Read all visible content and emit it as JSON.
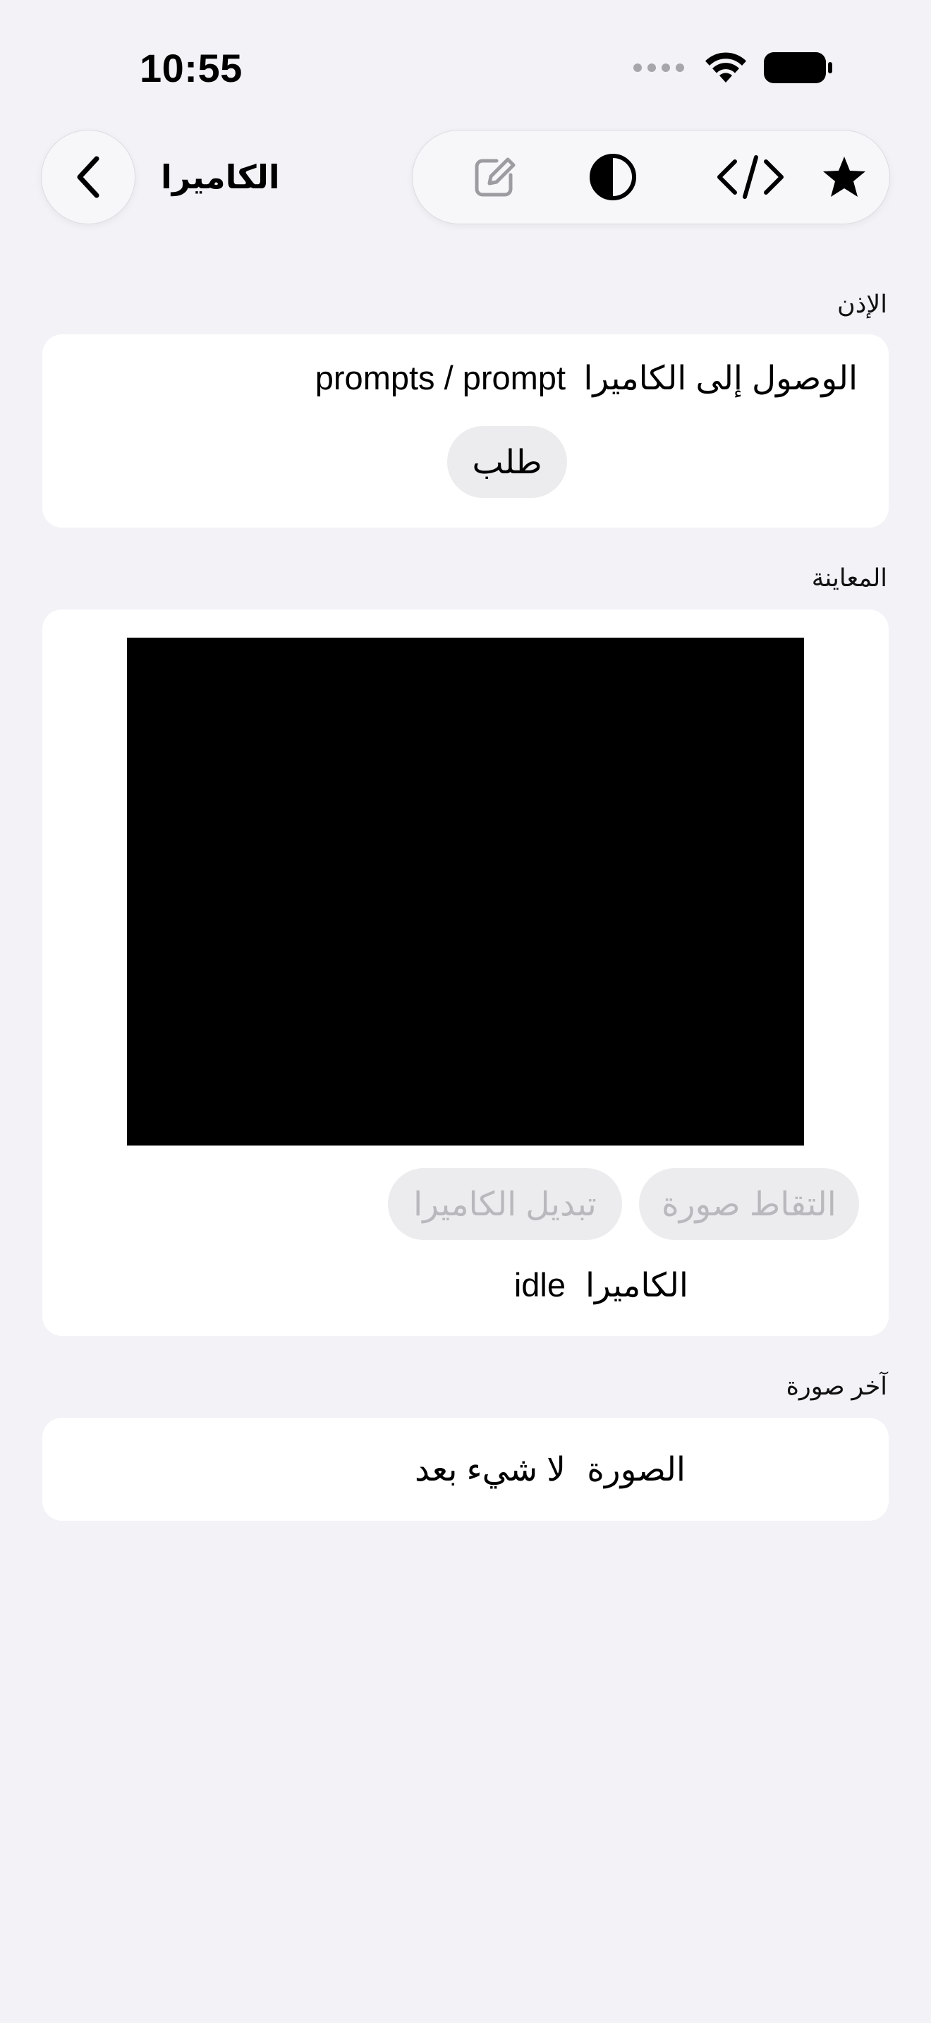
{
  "status_bar": {
    "time": "10:55"
  },
  "nav": {
    "title": "الكاميرا",
    "back_icon": "chevron-left-icon",
    "actions": [
      {
        "name": "edit-icon"
      },
      {
        "name": "contrast-icon"
      },
      {
        "name": "code-icon"
      },
      {
        "name": "star-icon"
      }
    ]
  },
  "permission": {
    "header": "الإذن",
    "label": "الوصول إلى الكاميرا",
    "value": "prompts / prompt",
    "request_button": "طلب"
  },
  "preview": {
    "header": "المعاينة",
    "capture_button": "التقاط صورة",
    "switch_button": "تبديل الكاميرا",
    "status_label": "الكاميرا",
    "status_value": "idle"
  },
  "last_photo": {
    "header": "آخر صورة",
    "label": "الصورة",
    "value": "لا شيء بعد"
  },
  "colors": {
    "background": "#f2f2f7",
    "card": "#ffffff",
    "button_fill": "#ececee",
    "disabled_text": "#b9b9bd",
    "preview": "#000000"
  }
}
